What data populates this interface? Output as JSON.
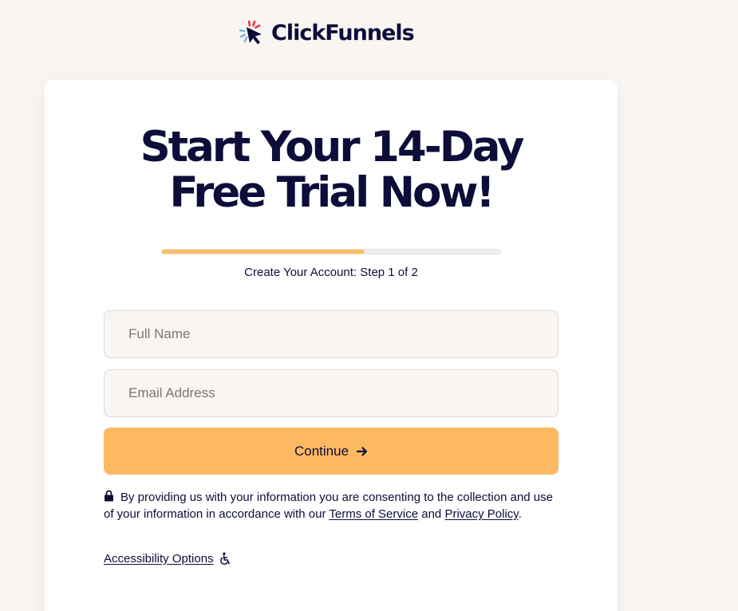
{
  "brand": {
    "name": "ClickFunnels",
    "icon": "clickfunnels-cursor-logo",
    "colors": {
      "red": "#e8344a",
      "blue": "#7ab6e0",
      "navy": "#0d0d3a"
    }
  },
  "headline": {
    "line1": "Start Your 14-Day",
    "line2": "Free Trial Now!"
  },
  "progress": {
    "fraction": 0.6,
    "color": "#fcbc62",
    "step_text": "Create Your Account: Step 1 of 2"
  },
  "form": {
    "full_name": {
      "placeholder": "Full Name",
      "value": ""
    },
    "email": {
      "placeholder": "Email Address",
      "value": ""
    },
    "continue_label": "Continue",
    "continue_icon": "arrow-right-icon",
    "button_color": "#fdb961"
  },
  "consent": {
    "icon": "lock-icon",
    "text_before": "By providing us with your information you are consenting to the collection and use of your information in accordance with our ",
    "terms_link": "Terms of Service",
    "text_middle": " and ",
    "privacy_link": "Privacy Policy",
    "text_after": "."
  },
  "accessibility": {
    "label": "Accessibility Options",
    "icon": "accessibility-icon"
  }
}
